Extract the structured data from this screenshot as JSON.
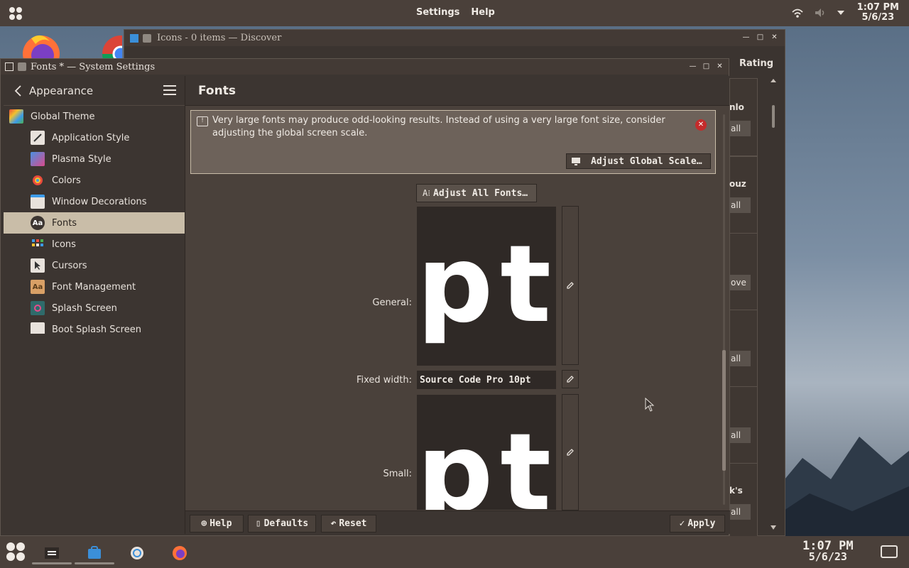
{
  "top_panel": {
    "menu": [
      "Settings",
      "Help"
    ],
    "clock_time": "1:07 PM",
    "clock_date": "5/6/23",
    "icons": [
      "app-launcher-icon",
      "network-icon",
      "volume-icon",
      "tray-arrow-icon"
    ]
  },
  "discover": {
    "title": "Icons - 0 items — Discover",
    "rating_header": "Rating",
    "cards": [
      {
        "title": "nlo",
        "button": "all"
      },
      {
        "title": "ouz",
        "button": "all"
      },
      {
        "title": "",
        "button": "ove"
      },
      {
        "title": "",
        "button": "all"
      },
      {
        "title": "",
        "button": "all"
      },
      {
        "title": "k's",
        "button": "all"
      }
    ]
  },
  "settings": {
    "window_title": "Fonts * — System Settings",
    "sidebar": {
      "header": "Appearance",
      "items": [
        {
          "label": "Global Theme",
          "icon": "global-theme-icon"
        },
        {
          "label": "Application Style",
          "icon": "application-style-icon"
        },
        {
          "label": "Plasma Style",
          "icon": "plasma-style-icon"
        },
        {
          "label": "Colors",
          "icon": "colors-icon"
        },
        {
          "label": "Window Decorations",
          "icon": "window-decorations-icon"
        },
        {
          "label": "Fonts",
          "icon": "fonts-icon"
        },
        {
          "label": "Icons",
          "icon": "icons-icon"
        },
        {
          "label": "Cursors",
          "icon": "cursors-icon"
        },
        {
          "label": "Font Management",
          "icon": "font-management-icon"
        },
        {
          "label": "Splash Screen",
          "icon": "splash-screen-icon"
        },
        {
          "label": "Boot Splash Screen",
          "icon": "boot-splash-screen-icon"
        }
      ]
    },
    "main": {
      "title": "Fonts",
      "warning": "Very large fonts may produce odd-looking results. Instead of using a very large font size, consider adjusting the global screen scale.",
      "adjust_scale_label": "Adjust Global Scale…",
      "adjust_all_fonts_label": "Adjust All Fonts…",
      "general_label": "General:",
      "general_preview": "pt",
      "fixed_width_label": "Fixed width:",
      "fixed_width_value": "Source Code Pro 10pt",
      "small_label": "Small:",
      "small_preview": "pt"
    },
    "footer": {
      "help": "Help",
      "defaults": "Defaults",
      "reset": "Reset",
      "apply": "Apply"
    }
  },
  "taskbar": {
    "clock_time": "1:07 PM",
    "clock_date": "5/6/23"
  }
}
